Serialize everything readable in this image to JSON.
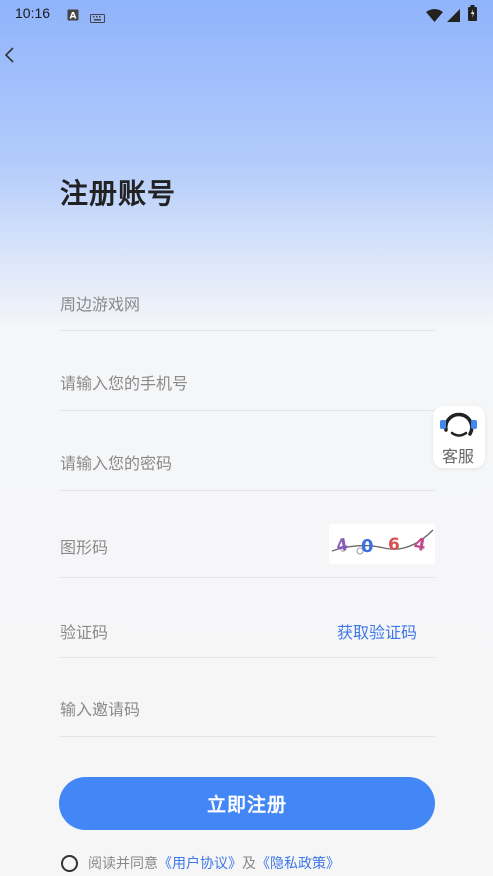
{
  "status_bar": {
    "time": "10:16"
  },
  "page": {
    "title": "注册账号"
  },
  "form": {
    "source_label": "周边游戏网",
    "phone_placeholder": "请输入您的手机号",
    "password_placeholder": "请输入您的密码",
    "captcha_label": "图形码",
    "captcha_value": "4064",
    "code_label": "验证码",
    "get_code_label": "获取验证码",
    "invite_placeholder": "输入邀请码"
  },
  "register_button": {
    "label": "立即注册"
  },
  "agreement": {
    "prefix": "阅读并同意",
    "user_agreement": "《用户协议》",
    "joiner": "及",
    "privacy_policy": "《隐私政策》"
  },
  "customer_service": {
    "label": "客服"
  },
  "colors": {
    "accent": "#4287f5",
    "link": "#3e77e8"
  }
}
